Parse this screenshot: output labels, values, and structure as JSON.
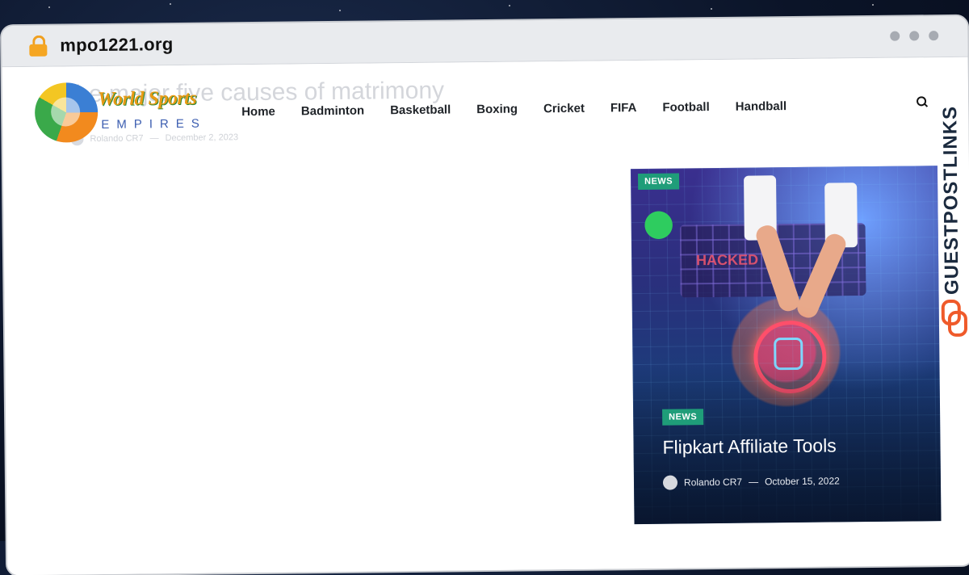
{
  "browser": {
    "url": "mpo1221.org"
  },
  "logo": {
    "title": "World Sports",
    "subtitle": "EMPIRES"
  },
  "ghost_post": {
    "title": "The major five causes of matrimony",
    "author": "Rolando CR7",
    "date": "December 2, 2023"
  },
  "nav": {
    "items": [
      "Home",
      "Badminton",
      "Basketball",
      "Boxing",
      "Cricket",
      "FIFA",
      "Football",
      "Handball"
    ]
  },
  "featured": {
    "category_top": "NEWS",
    "category": "NEWS",
    "title": "Flipkart Affiliate Tools",
    "author": "Rolando CR7",
    "separator": "—",
    "date": "October 15, 2022",
    "image_text": "HACKED"
  },
  "watermark": {
    "text": "GUESTPOSTLINKS"
  },
  "colors": {
    "badge": "#1f9d79",
    "watermark_accent": "#ef5a2a",
    "lock": "#f5a623"
  }
}
